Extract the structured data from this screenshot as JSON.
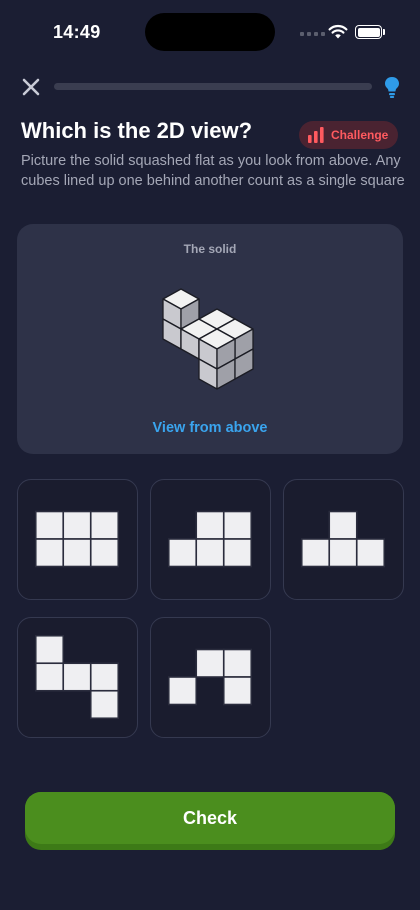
{
  "status_bar": {
    "time": "14:49"
  },
  "header": {
    "progress_fraction": 0.0,
    "close_icon": "close-icon",
    "hint_icon": "lightbulb-icon"
  },
  "question": {
    "title": "Which is the 2D view?",
    "badge_label": "Challenge",
    "badge_color": "#ff5a5f",
    "description": "Picture the solid squashed flat as you look from above. Any cubes lined up one behind another count as a single square"
  },
  "solid_card": {
    "label": "The solid",
    "view_link": "View from above"
  },
  "options": [
    {
      "id": "a",
      "cells": [
        [
          0,
          0
        ],
        [
          1,
          0
        ],
        [
          2,
          0
        ],
        [
          0,
          1
        ],
        [
          1,
          1
        ],
        [
          2,
          1
        ]
      ]
    },
    {
      "id": "b",
      "cells": [
        [
          1,
          0
        ],
        [
          2,
          0
        ],
        [
          0,
          1
        ],
        [
          1,
          1
        ],
        [
          2,
          1
        ]
      ]
    },
    {
      "id": "c",
      "cells": [
        [
          1,
          0
        ],
        [
          0,
          1
        ],
        [
          1,
          1
        ],
        [
          2,
          1
        ]
      ]
    },
    {
      "id": "d",
      "cells": [
        [
          0,
          0
        ],
        [
          0,
          1
        ],
        [
          1,
          1
        ],
        [
          2,
          1
        ],
        [
          2,
          2
        ]
      ]
    },
    {
      "id": "e",
      "cells": [
        [
          1,
          0
        ],
        [
          2,
          0
        ],
        [
          0,
          1
        ],
        [
          2,
          1
        ]
      ]
    }
  ],
  "check_button": {
    "label": "Check"
  },
  "colors": {
    "accent_green": "#4b8e1e",
    "link_blue": "#3aa4ee",
    "background": "#1b1e33"
  }
}
